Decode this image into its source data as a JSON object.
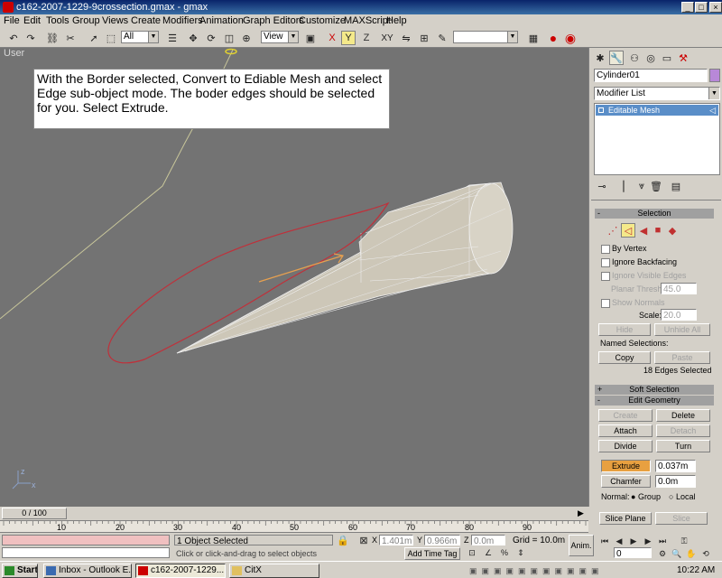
{
  "window": {
    "title": "c162-2007-1229-9crossection.gmax - gmax"
  },
  "menu": [
    "File",
    "Edit",
    "Tools",
    "Group",
    "Views",
    "Create",
    "Modifiers",
    "Animation",
    "Graph Editors",
    "Customize",
    "MAXScript",
    "Help"
  ],
  "toolbar": {
    "selection_filter": "All",
    "coord_system": "View",
    "axis_xy": "XY"
  },
  "viewport": {
    "label": "User",
    "callout": "With the Border selected, Convert to Ediable Mesh and select Edge sub-object mode.  The boder edges should be selected for you.  Select Extrude.",
    "axis_x": "x",
    "axis_z": "z"
  },
  "command_panel": {
    "object_name": "Cylinder01",
    "modifier_list": "Modifier List",
    "stack_item": "Editable Mesh",
    "selection": {
      "title": "Selection",
      "by_vertex": "By Vertex",
      "ignore_backfacing": "Ignore Backfacing",
      "ignore_visible_edges": "Ignore Visible Edges",
      "planar_thresh_label": "Planar Thresh:",
      "planar_thresh_value": "45.0",
      "show_normals": "Show Normals",
      "scale_label": "Scale:",
      "scale_value": "20.0",
      "hide": "Hide",
      "unhide_all": "Unhide All",
      "named_selections": "Named Selections:",
      "copy": "Copy",
      "paste": "Paste",
      "status": "18 Edges Selected"
    },
    "soft_selection": {
      "title": "Soft Selection",
      "sign": "+"
    },
    "edit_geometry": {
      "title": "Edit Geometry",
      "sign": "-",
      "create": "Create",
      "delete": "Delete",
      "attach": "Attach",
      "detach": "Detach",
      "divide": "Divide",
      "turn": "Turn",
      "extrude": "Extrude",
      "extrude_value": "0.037m",
      "chamfer": "Chamfer",
      "chamfer_value": "0.0m",
      "normal_label": "Normal:",
      "group": "Group",
      "local": "Local",
      "slice_plane": "Slice Plane",
      "slice": "Slice"
    }
  },
  "timeline": {
    "frame_display": "0 / 100",
    "ticks": [
      "10",
      "20",
      "30",
      "40",
      "50",
      "60",
      "70",
      "80",
      "90"
    ],
    "progress": 0
  },
  "status": {
    "selected": "1 Object Selected",
    "prompt": "Click or click-and-drag to select objects",
    "x_label": "X",
    "x_value": "1.401m",
    "y_label": "Y",
    "y_value": "0.966m",
    "z_label": "Z",
    "z_value": "0.0m",
    "grid": "Grid = 10.0m",
    "add_time_tag": "Add Time Tag",
    "anim": "Anim.",
    "frame_field": "0"
  },
  "taskbar": {
    "start": "Start",
    "tasks": [
      "Inbox - Outlook E...",
      "c162-2007-1229...",
      "CitX"
    ],
    "clock": "10:22 AM"
  }
}
